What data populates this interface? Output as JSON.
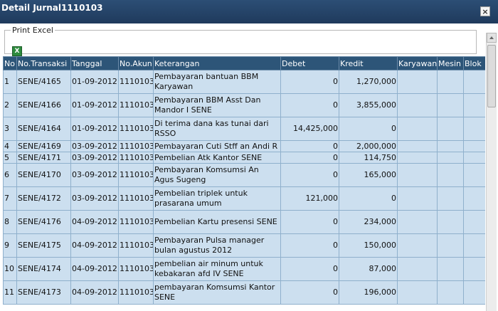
{
  "window": {
    "title": "Detail Jurnal1110103",
    "close_glyph": "×"
  },
  "tools": {
    "legend": "Print Excel",
    "excel_icon_letter": "X"
  },
  "table": {
    "headers": [
      "No",
      "No.Transaksi",
      "Tanggal",
      "No.Akun",
      "Keterangan",
      "Debet",
      "Kredit",
      "Karyawan",
      "Mesin",
      "Blok"
    ],
    "rows": [
      [
        "1",
        "SENE/4165",
        "01-09-2012",
        "1110103",
        "Pembayaran bantuan BBM Karyawan",
        "0",
        "1,270,000",
        "",
        "",
        ""
      ],
      [
        "2",
        "SENE/4166",
        "01-09-2012",
        "1110103",
        "Pembayaran BBM Asst Dan Mandor I SENE",
        "0",
        "3,855,000",
        "",
        "",
        ""
      ],
      [
        "3",
        "SENE/4164",
        "01-09-2012",
        "1110103",
        "Di terima dana kas tunai dari RSSO",
        "14,425,000",
        "0",
        "",
        "",
        ""
      ],
      [
        "4",
        "SENE/4169",
        "03-09-2012",
        "1110103",
        "Pembayaran Cuti Stff an Andi R",
        "0",
        "2,000,000",
        "",
        "",
        ""
      ],
      [
        "5",
        "SENE/4171",
        "03-09-2012",
        "1110103",
        "Pembelian Atk Kantor SENE",
        "0",
        "114,750",
        "",
        "",
        ""
      ],
      [
        "6",
        "SENE/4170",
        "03-09-2012",
        "1110103",
        "Pembayaran Komsumsi An Agus Sugeng",
        "0",
        "165,000",
        "",
        "",
        ""
      ],
      [
        "7",
        "SENE/4172",
        "03-09-2012",
        "1110103",
        "Pembelian triplek untuk prasarana umum",
        "121,000",
        "0",
        "",
        "",
        ""
      ],
      [
        "8",
        "SENE/4176",
        "04-09-2012",
        "1110103",
        "Pembelian Kartu presensi SENE",
        "0",
        "234,000",
        "",
        "",
        ""
      ],
      [
        "9",
        "SENE/4175",
        "04-09-2012",
        "1110103",
        "Pembayaran Pulsa manager bulan agustus 2012",
        "0",
        "150,000",
        "",
        "",
        ""
      ],
      [
        "10",
        "SENE/4174",
        "04-09-2012",
        "1110103",
        "pembelian air minum untuk kebakaran afd IV SENE",
        "0",
        "87,000",
        "",
        "",
        ""
      ],
      [
        "11",
        "SENE/4173",
        "04-09-2012",
        "1110103",
        "pembayaran Komsumsi Kantor SENE",
        "0",
        "196,000",
        "",
        "",
        ""
      ]
    ]
  },
  "colors": {
    "header_bg": "#2d5578",
    "row_bg": "#ccdfef",
    "titlebar_bg": "#1f3a5c"
  }
}
